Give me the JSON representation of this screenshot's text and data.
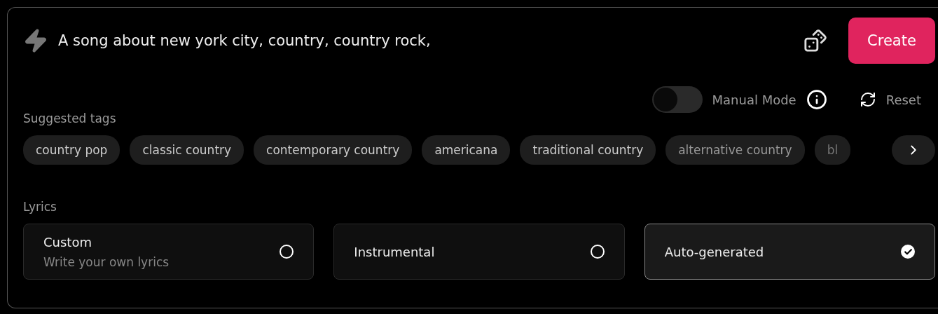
{
  "prompt": {
    "value": "A song about new york city, country, country rock, "
  },
  "create_button": "Create",
  "manual_mode": {
    "label": "Manual Mode",
    "on": false
  },
  "reset_button": "Reset",
  "suggested_tags": {
    "label": "Suggested tags",
    "tags": [
      {
        "label": "country pop"
      },
      {
        "label": "classic country"
      },
      {
        "label": "contemporary country"
      },
      {
        "label": "americana"
      },
      {
        "label": "traditional country"
      },
      {
        "label": "alternative country"
      },
      {
        "label": "bl"
      }
    ]
  },
  "lyrics": {
    "label": "Lyrics",
    "options": [
      {
        "title": "Custom",
        "subtitle": "Write your own lyrics",
        "selected": false
      },
      {
        "title": "Instrumental",
        "selected": false
      },
      {
        "title": "Auto-generated",
        "selected": true
      }
    ]
  }
}
